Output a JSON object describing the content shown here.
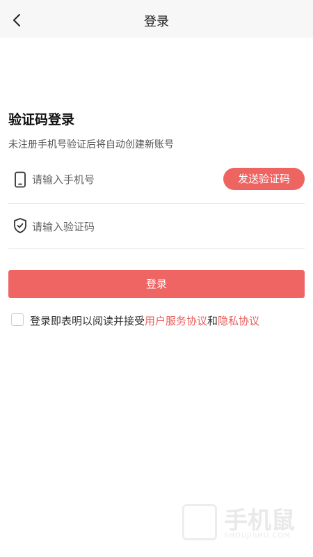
{
  "nav": {
    "title": "登录"
  },
  "login": {
    "title": "验证码登录",
    "subtitle": "未注册手机号验证后将自动创建新账号",
    "phone_placeholder": "请输入手机号",
    "code_placeholder": "请输入验证码",
    "send_code_label": "发送验证码",
    "submit_label": "登录"
  },
  "agreement": {
    "prefix": "登录即表明以阅读并接受",
    "terms_link": "用户服务协议",
    "conjunction": "和",
    "privacy_link": "隐私协议"
  },
  "watermark": {
    "text": "手机鼠",
    "sub": "SHOUJISHU.COM"
  },
  "colors": {
    "accent": "#ee6461",
    "link": "#e85f5c",
    "nav_bg": "#f7f7f7"
  },
  "icons": {
    "back": "chevron-left-icon",
    "phone": "phone-icon",
    "code": "shield-check-icon"
  }
}
